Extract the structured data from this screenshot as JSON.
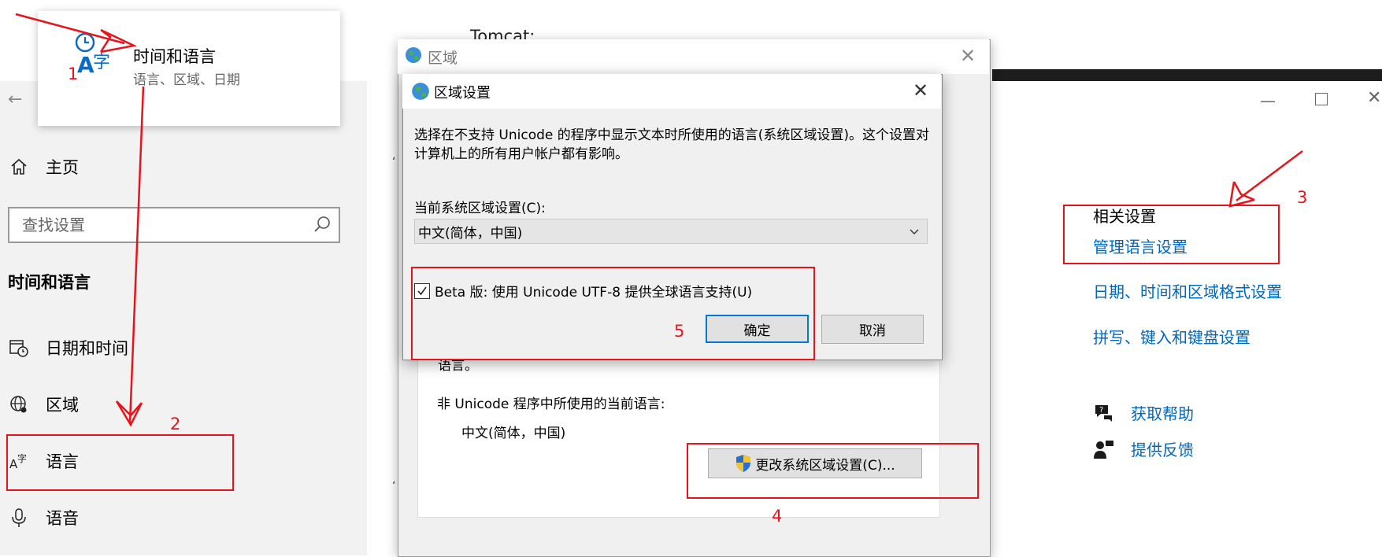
{
  "popup": {
    "title": "时间和语言",
    "subtitle": "语言、区域、日期",
    "behind_text": "Tomcat:"
  },
  "settings": {
    "nav": {
      "home": "主页",
      "search_placeholder": "查找设置",
      "section_title": "时间和语言",
      "items": [
        {
          "label": "日期和时间",
          "icon": "datetime-icon"
        },
        {
          "label": "区域",
          "icon": "region-globe-icon"
        },
        {
          "label": "语言",
          "icon": "language-icon"
        },
        {
          "label": "语音",
          "icon": "microphone-icon"
        }
      ]
    },
    "related": {
      "title": "相关设置",
      "links": [
        "管理语言设置",
        "日期、时间和区域格式设置",
        "拼写、键入和键盘设置"
      ],
      "help": "获取帮助",
      "feedback": "提供反馈"
    }
  },
  "region_dialog": {
    "title": "区域",
    "fragment": "语言。",
    "nonunicode_label": "非 Unicode 程序中所使用的当前语言:",
    "nonunicode_value": "中文(简体，中国)",
    "change_button": "更改系统区域设置(C)..."
  },
  "locale_dialog": {
    "title": "区域设置",
    "description": "选择在不支持 Unicode 的程序中显示文本时所使用的语言(系统区域设置)。这个设置对计算机上的所有用户帐户都有影响。",
    "current_label": "当前系统区域设置(C):",
    "current_value": "中文(简体，中国)",
    "beta_label": "Beta 版: 使用 Unicode UTF-8 提供全球语言支持(U)",
    "beta_checked": true,
    "ok": "确定",
    "cancel": "取消"
  },
  "annotations": {
    "n1": "1",
    "n2": "2",
    "n3": "3",
    "n4": "4",
    "n5": "5",
    "color": "#e8141c"
  },
  "colors": {
    "link": "#0067c0",
    "nav_bg": "#f2f2f2",
    "dialog_bg": "#f0f0f0",
    "focus": "#0078d7"
  }
}
